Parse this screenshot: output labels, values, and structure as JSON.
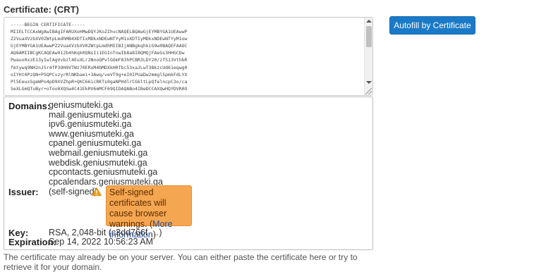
{
  "certificate": {
    "label": "Certificate: (CRT)",
    "text": "-----BEGIN CERTIFICATE-----\nMIIELTCCAxWgAwIBAgIFARUXoHMwDQYJKoZIhvcNAQELBQAwGjEYMBYGA1UEAwwP\nZ2VuaXVzbXV0ZWtpLmdhMB4XDTIxMDkxNDEwNTYyM1oXDTIyMDkxNDEwNTYyM1ow\nGjEYMBYGA1UEAwwPZ2VuaXVzbXV0ZWtpLmdhMIIBIjANBgkqhkiG9w0BAQEFAAOC\nAQ8AMIIBCgKCAQEAw912b4hKqk0QNsIi1EGInTnwIb8a8I8QMQjFAeGs3HHGCDw\nPwauo0xzE13yIwlAgVvbzl4EuXLr2NnoQPvlGOmF83hPCBR3LDY20/zfS13VthbR\nfmtywq9NH2nJ5r4fP3OH9VTWz70ERxM4bMDXkHRfbc53xaJLwT3BkzcUd61eqwg0\noIYHt0PzQN+P5QPCvzyrRlNKbaei+3Awq/veVT9g+eI0IPUaDw2mmgl5pmkFdLYX\nPl5EeuxSgeWPo4pD9XVZhpR+QKC66icRKTs0gaNPHdlrCGkltLpQfelncpC3o/ca\nSeXLGmQTuByr+oToo0XQSw4C41EkRV6mMCF69QIDAQABo4IBeDCCAXQwHQYDVR0O"
  },
  "details": {
    "domains_label": "Domains:",
    "domains": [
      "geniusmuteki.ga",
      "mail.geniusmuteki.ga",
      "ipv6.geniusmuteki.ga",
      "www.geniusmuteki.ga",
      "cpanel.geniusmuteki.ga",
      "webmail.geniusmuteki.ga",
      "webdisk.geniusmuteki.ga",
      "cpcontacts.geniusmuteki.ga",
      "cpcalendars.geniusmuteki.ga"
    ],
    "issuer_label": "Issuer:",
    "issuer_value": "(self-signed)",
    "warning_text": "Self-signed certificates will cause browser warnings.",
    "warning_open_paren": "(",
    "warning_link": "More information",
    "warning_close_paren": ")",
    "key_label": "Key:",
    "key_value": "RSA, 2,048-bit (c3dd766f …)",
    "expiration_label": "Expiration:",
    "expiration_value": "Sep 14, 2022 10:56:23 AM"
  },
  "footer_text": "The certificate may already be on your server. You can either paste the certificate here or try to retrieve it for your domain.",
  "autofill_button": {
    "label": "Autofill by Certificate"
  },
  "colors": {
    "button_bg": "#1a7ac8",
    "warning_bg": "#f5a651",
    "warning_icon": "#f39c12",
    "link": "#1f4e9c"
  },
  "icons": {
    "warning": "warning-triangle-icon"
  }
}
